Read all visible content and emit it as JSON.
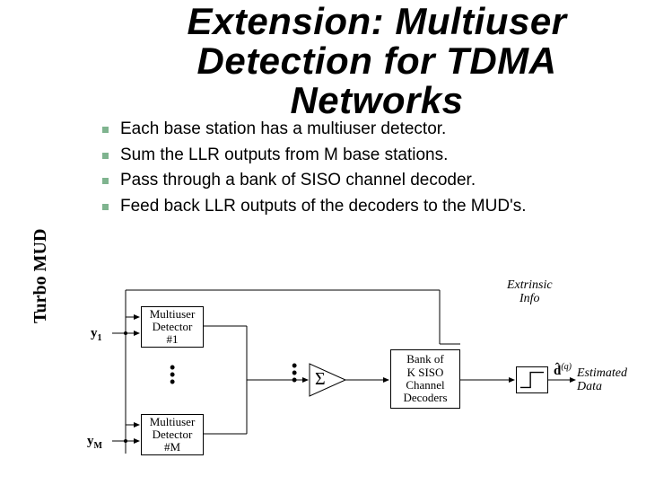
{
  "title": "Extension: Multiuser Detection for TDMA Networks",
  "sidebar_label": "Turbo MUD",
  "bullets": [
    "Each base station has a multiuser detector.",
    "Sum the LLR outputs from M base stations.",
    "Pass through a bank of SISO channel decoder.",
    "Feed back LLR outputs of the decoders to the MUD's."
  ],
  "diagram": {
    "y1": "y",
    "y1_sub": "1",
    "yM": "y",
    "yM_sub": "M",
    "mud1": "Multiuser\nDetector\n#1",
    "mudM": "Multiuser\nDetector\n#M",
    "sigma": "Σ",
    "decoders": "Bank of\nK SISO\nChannel\nDecoders",
    "extrinsic": "Extrinsic\nInfo",
    "estimated": "Estimated\nData",
    "dhat": "d̂",
    "dhat_sup": "(q)"
  }
}
